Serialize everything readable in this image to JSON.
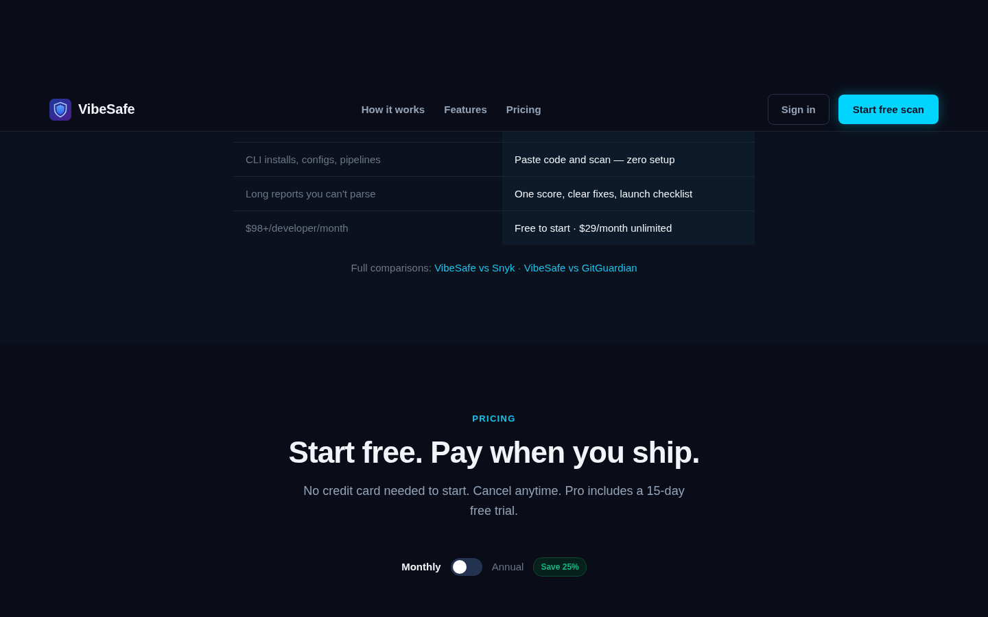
{
  "header": {
    "brand": "VibeSafe",
    "nav": [
      {
        "label": "How it works"
      },
      {
        "label": "Features"
      },
      {
        "label": "Pricing"
      }
    ],
    "sign_in": "Sign in",
    "cta": "Start free scan"
  },
  "comparison": {
    "rows": [
      {
        "others": "CLI installs, configs, pipelines",
        "vibesafe": "Paste code and scan — zero setup"
      },
      {
        "others": "Long reports you can't parse",
        "vibesafe": "One score, clear fixes, launch checklist"
      },
      {
        "others": "$98+/developer/month",
        "vibesafe": "Free to start · $29/month unlimited"
      }
    ],
    "links_label": "Full comparisons:",
    "links": [
      {
        "label": "VibeSafe vs Snyk"
      },
      {
        "label": "VibeSafe vs GitGuardian"
      }
    ],
    "separator": "·"
  },
  "pricing": {
    "eyebrow": "PRICING",
    "title": "Start free. Pay when you ship.",
    "subtitle": "No credit card needed to start. Cancel anytime. Pro includes a 15-day free trial.",
    "billing": {
      "monthly_label": "Monthly",
      "annual_label": "Annual",
      "annual": false,
      "badge": "Save 25%"
    }
  }
}
